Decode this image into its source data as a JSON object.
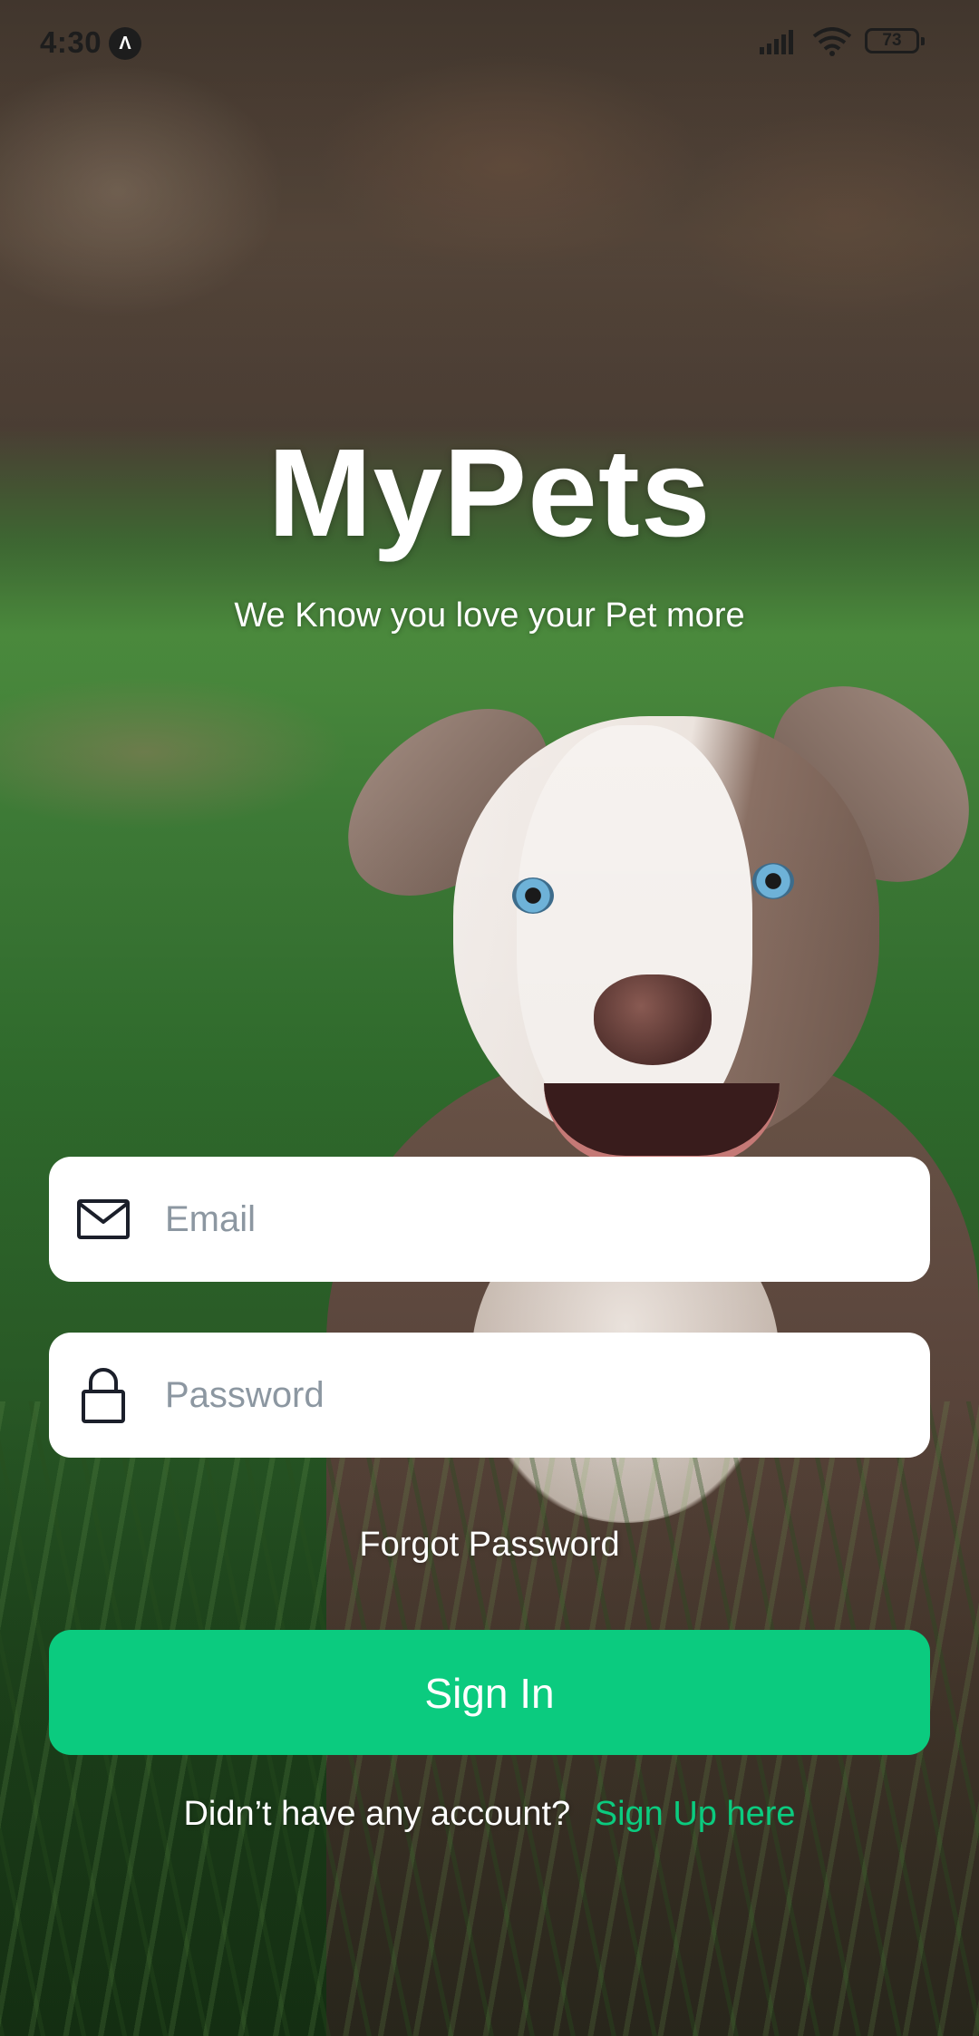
{
  "status_bar": {
    "time": "4:30",
    "app_icon_glyph": "Λ",
    "battery": "73"
  },
  "header": {
    "title": "MyPets",
    "tagline": "We Know you love your Pet more"
  },
  "form": {
    "email_placeholder": "Email",
    "password_placeholder": "Password",
    "forgot_password": "Forgot Password",
    "sign_in": "Sign In"
  },
  "footer": {
    "prompt": "Didn’t have any account?",
    "sign_up_link": "Sign Up here"
  },
  "icons": {
    "email": "envelope-icon",
    "password": "lock-icon"
  },
  "colors": {
    "accent": "#0bcb7f",
    "text_on_image": "#ffffff",
    "placeholder": "#8c97a1"
  }
}
